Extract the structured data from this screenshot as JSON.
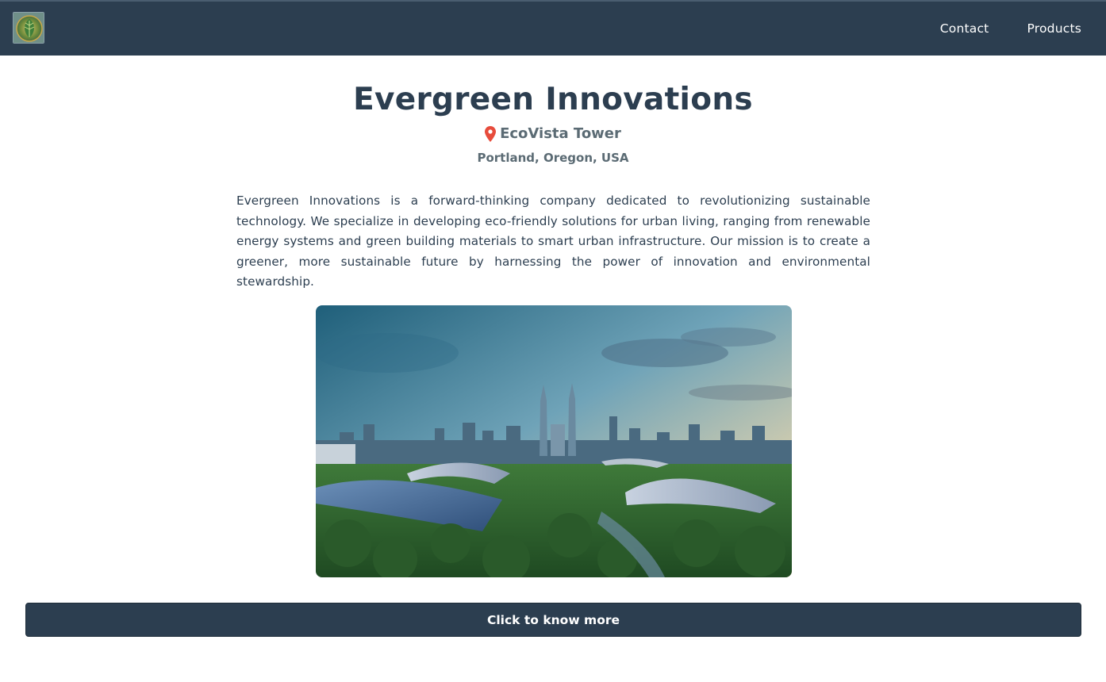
{
  "header": {
    "logo_name": "leaf-emblem-logo",
    "nav": [
      {
        "label": "Contact"
      },
      {
        "label": "Products"
      }
    ]
  },
  "main": {
    "title": "Evergreen Innovations",
    "building": "EcoVista Tower",
    "location": "Portland, Oregon, USA",
    "description": "Evergreen Innovations is a forward-thinking company dedicated to revolutionizing sustainable technology. We specialize in developing eco-friendly solutions for urban living, ranging from renewable energy systems and green building materials to smart urban infrastructure. Our mission is to create a greener, more sustainable future by harnessing the power of innovation and environmental stewardship.",
    "cta_label": "Click to know more"
  },
  "colors": {
    "header_bg": "#2c3e50",
    "title": "#2c3e50",
    "subtitle": "#5b6b74",
    "pin": "#e74c3c"
  }
}
